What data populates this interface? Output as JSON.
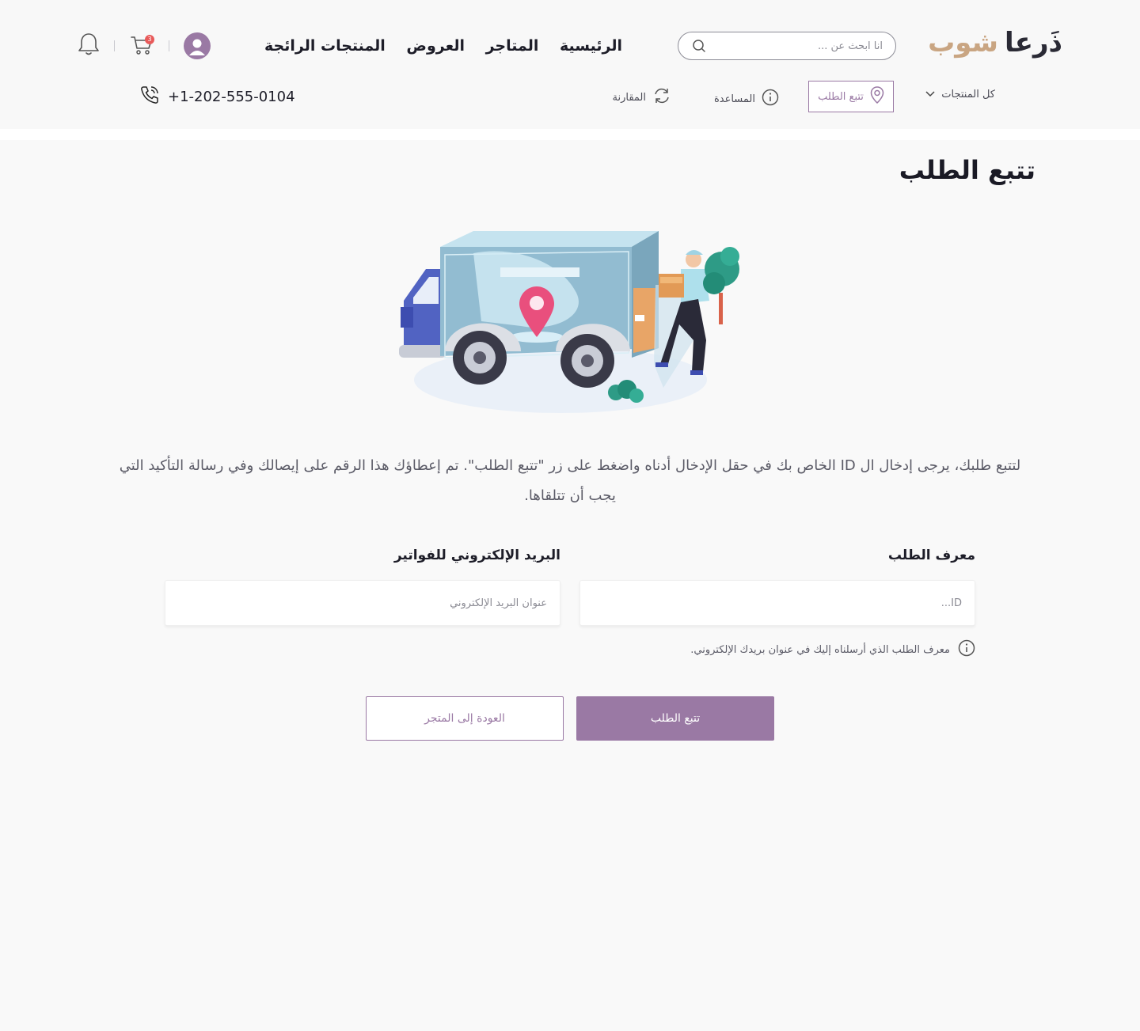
{
  "logo": {
    "part_dark": "ذَرعا",
    "part_accent": "شوب"
  },
  "search": {
    "placeholder": "انا ابحث عن ..."
  },
  "nav": {
    "home": "الرئيسية",
    "stores": "المتاجر",
    "offers": "العروض",
    "trending": "المنتجات الرائجة"
  },
  "cart": {
    "count": "3"
  },
  "subnav": {
    "all_products": "كل المنتجات",
    "track_order": "تتبع الطلب",
    "help": "المساعدة",
    "compare": "المقارنة",
    "phone": "+1-202-555-0104"
  },
  "page": {
    "title": "تتبع الطلب",
    "description": "لتتبع طلبك، يرجى إدخال ال ID الخاص بك في حقل الإدخال أدناه واضغط على زر \"تتبع الطلب\". تم إعطاؤك هذا الرقم على إيصالك وفي رسالة التأكيد التي يجب أن تتلقاها."
  },
  "form": {
    "order_id_label": "معرف الطلب",
    "order_id_placeholder": "ID...",
    "email_label": "البريد الإلكتروني للفواتير",
    "email_placeholder": "عنوان البريد الإلكتروني",
    "hint": "معرف الطلب الذي أرسلناه إليك في عنوان بريدك الإلكتروني."
  },
  "buttons": {
    "track": "تتبع الطلب",
    "back": "العودة إلى المتجر"
  },
  "colors": {
    "accent": "#9a79a4",
    "logo_accent": "#c9a582",
    "badge": "#e85a5a"
  }
}
